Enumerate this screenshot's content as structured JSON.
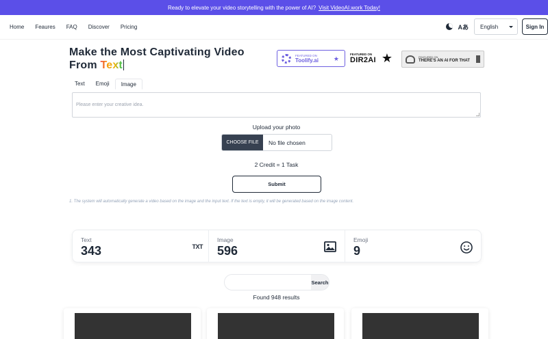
{
  "banner": {
    "text": "Ready to elevate your video storytelling with the power of AI?",
    "link": "Visit VideoAI.work Today!"
  },
  "nav": {
    "links": [
      "Home",
      "Feaures",
      "FAQ",
      "Discover",
      "Pricing"
    ],
    "translate_icon": "Aあ",
    "language": "English",
    "signin": "Sign In"
  },
  "hero": {
    "title_line1": "Make the Most Captivating Video",
    "title_line2_prefix": "From ",
    "title_highlight": "Text"
  },
  "badges": {
    "toolify": {
      "small": "FEATURED ON",
      "name": "Toolify.ai"
    },
    "dir2ai": {
      "small": "FEATURED ON",
      "name": "DIR2AI"
    },
    "aiforthat": {
      "small": "FEATURED ON",
      "name": "THERE'S AN AI FOR THAT"
    }
  },
  "tabs": [
    "Text",
    "Emoji",
    "Image"
  ],
  "form": {
    "placeholder": "Please enter your creative idea.",
    "upload_label": "Upload your photo",
    "file_button": "CHOOSE FILE",
    "file_status": "No file chosen",
    "credit": "2 Credit = 1 Task",
    "submit": "Submit",
    "note": "1. The system will automatically generate a video based on the image and the input text. If the text is empty, it will be generated based on the image content."
  },
  "stats": [
    {
      "label": "Text",
      "value": "343",
      "icon": "TXT"
    },
    {
      "label": "Image",
      "value": "596",
      "icon": "image-icon"
    },
    {
      "label": "Emoji",
      "value": "9",
      "icon": "smiley-icon"
    }
  ],
  "search": {
    "placeholder": "",
    "button": "Search",
    "results": "Found 948 results"
  },
  "colors": {
    "banner": "#5b4fe8",
    "toolify": "#6d5fe0",
    "file_button": "#374151"
  }
}
